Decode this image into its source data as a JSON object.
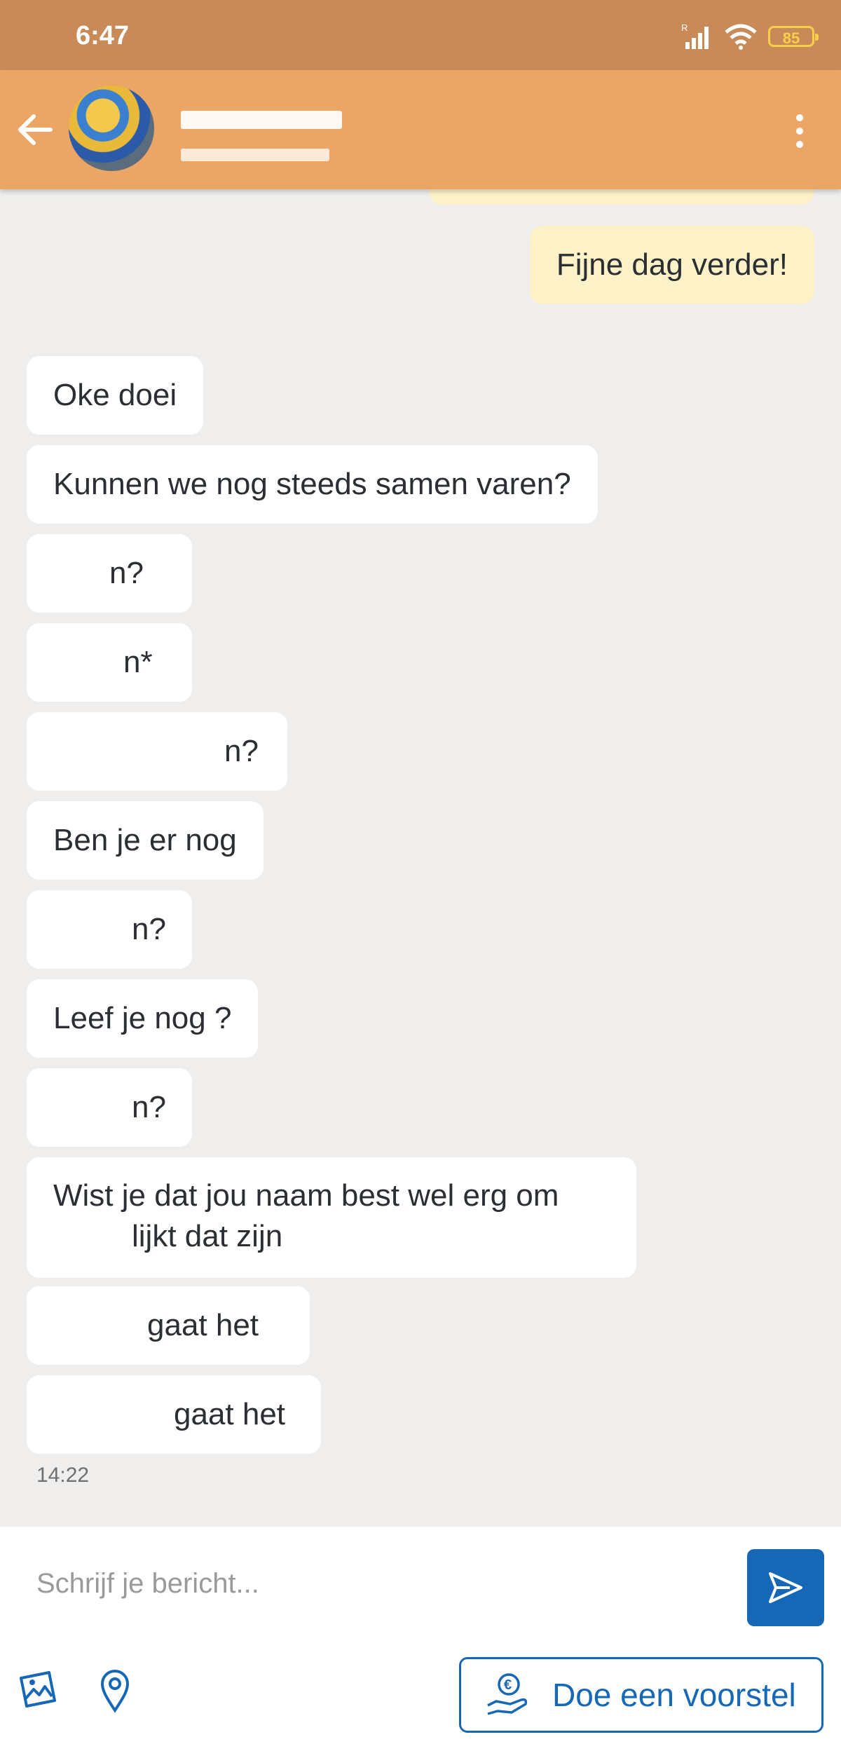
{
  "status_bar": {
    "time": "6:47",
    "battery": "85"
  },
  "header": {
    "back_label": "Terug"
  },
  "messages": [
    {
      "direction": "outgoing",
      "text": "Fijne dag verder!"
    },
    {
      "direction": "incoming",
      "text": "Oke doei"
    },
    {
      "direction": "incoming",
      "text": "Kunnen we nog steeds samen varen?"
    },
    {
      "direction": "incoming",
      "text": "n?"
    },
    {
      "direction": "incoming",
      "text": "n*"
    },
    {
      "direction": "incoming",
      "text": "n?"
    },
    {
      "direction": "incoming",
      "text": "Ben je er nog"
    },
    {
      "direction": "incoming",
      "text": "n?"
    },
    {
      "direction": "incoming",
      "text": "Leef je nog ?"
    },
    {
      "direction": "incoming",
      "text": "n?"
    },
    {
      "direction": "incoming",
      "text": "Wist je dat jou naam best wel erg om",
      "line2": "lijkt dat zijn"
    },
    {
      "direction": "incoming",
      "text": "gaat het"
    },
    {
      "direction": "incoming",
      "text": "gaat het"
    }
  ],
  "timestamp": "14:22",
  "composer": {
    "placeholder": "Schrijf je bericht..."
  },
  "actions": {
    "proposal_label": "Doe een voorstel"
  },
  "colors": {
    "status_bar": "#c88b58",
    "app_bar": "#eba564",
    "accent": "#1667b5",
    "outgoing_bubble": "#fdf1c8",
    "incoming_bubble": "#ffffff",
    "background": "#efeeed"
  },
  "icons": [
    "back-arrow-icon",
    "more-vert-icon",
    "send-icon",
    "image-icon",
    "location-pin-icon",
    "euro-hand-icon",
    "signal-icon",
    "wifi-icon",
    "battery-icon"
  ]
}
